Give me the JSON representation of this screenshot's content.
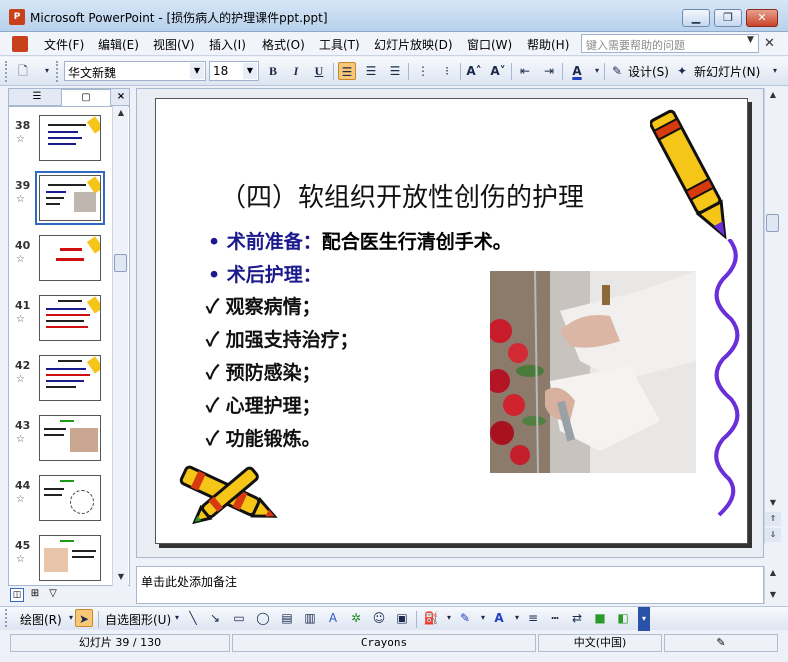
{
  "window": {
    "app_icon_label": "P",
    "title": "Microsoft PowerPoint - [损伤病人的护理课件ppt.ppt]",
    "min_icon": "minimize-icon",
    "max_icon": "restore-icon",
    "close_icon": "close-icon"
  },
  "menu": {
    "items": [
      "文件(F)",
      "编辑(E)",
      "视图(V)",
      "插入(I)",
      "格式(O)",
      "工具(T)",
      "幻灯片放映(D)",
      "窗口(W)",
      "帮助(H)"
    ],
    "help_placeholder": "键入需要帮助的问题"
  },
  "toolbar": {
    "font_name": "华文新魏",
    "font_size": "18",
    "bold": "B",
    "italic": "I",
    "underline": "U",
    "increase_font": "A˄",
    "decrease_font": "A˅",
    "font_color_label": "A",
    "design_label": "设计(S)",
    "new_slide_label": "新幻灯片(N)"
  },
  "panel": {
    "thumbnails": [
      {
        "num": "38",
        "star": "☆"
      },
      {
        "num": "39",
        "star": "☆"
      },
      {
        "num": "40",
        "star": "☆"
      },
      {
        "num": "41",
        "star": "☆"
      },
      {
        "num": "42",
        "star": "☆"
      },
      {
        "num": "43",
        "star": "☆"
      },
      {
        "num": "44",
        "star": "☆"
      },
      {
        "num": "45",
        "star": "☆"
      }
    ],
    "selected": "39",
    "close_label": "×"
  },
  "slide": {
    "title": "（四）软组织开放性创伤的护理",
    "bullet1_label": "术前准备：",
    "bullet1_text": "配合医生行清创手术。",
    "bullet2_label": "术后护理：",
    "checks": [
      "观察病情；",
      "加强支持治疗；",
      "预防感染；",
      "心理护理；",
      "功能锻炼。"
    ],
    "bullet_char": "•",
    "check_char": "✓"
  },
  "notes": {
    "placeholder": "单击此处添加备注"
  },
  "drawbar": {
    "draw_label": "绘图(R)",
    "autoshape_label": "自选图形(U)"
  },
  "status": {
    "slide_info": "幻灯片 39 / 130",
    "design": "Crayons",
    "language": "中文(中国)"
  },
  "colors": {
    "accent": "#316ac5",
    "bullet_blue": "#1a1a8c",
    "crayon_yellow": "#f5c518",
    "crayon_purple": "#6a2fd8"
  }
}
